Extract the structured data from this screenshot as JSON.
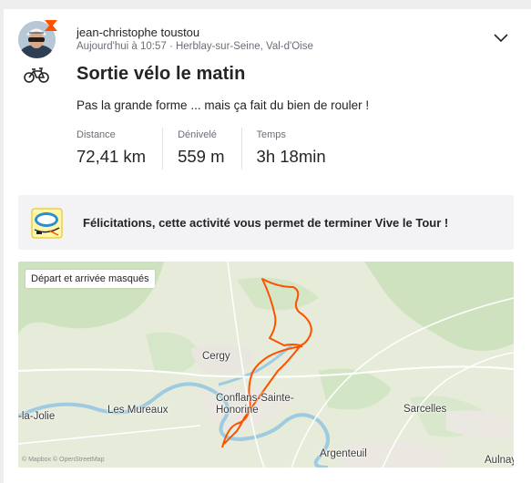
{
  "activity": {
    "athlete_name": "jean-christophe toustou",
    "meta": "Aujourd'hui à 10:57 · Herblay-sur-Seine, Val-d'Oise",
    "sport_icon": "bike-icon",
    "title": "Sortie vélo le matin",
    "description": "Pas la grande forme ... mais ça fait du bien de rouler !",
    "stats": [
      {
        "label": "Distance",
        "value": "72,41 km"
      },
      {
        "label": "Dénivelé",
        "value": "559 m"
      },
      {
        "label": "Temps",
        "value": "3h 18min"
      }
    ]
  },
  "promo": {
    "logo_icon": "vive-le-tour-badge-icon",
    "text": "Félicitations, cette activité vous permet de terminer Vive le Tour !"
  },
  "map": {
    "privacy_label": "Départ et arrivée masqués",
    "places": [
      "Cergy",
      "Conflans-Sainte-Honorine",
      "Les Mureaux",
      "Sarcelles",
      "Argenteuil",
      "-la-Jolie",
      "Aulnay"
    ],
    "attribution": "© Mapbox © OpenStreetMap",
    "route_color": "#fc5200"
  },
  "colors": {
    "accent": "#fc5200",
    "map_water": "#9ecbe0",
    "map_land": "#e6ecd9"
  }
}
